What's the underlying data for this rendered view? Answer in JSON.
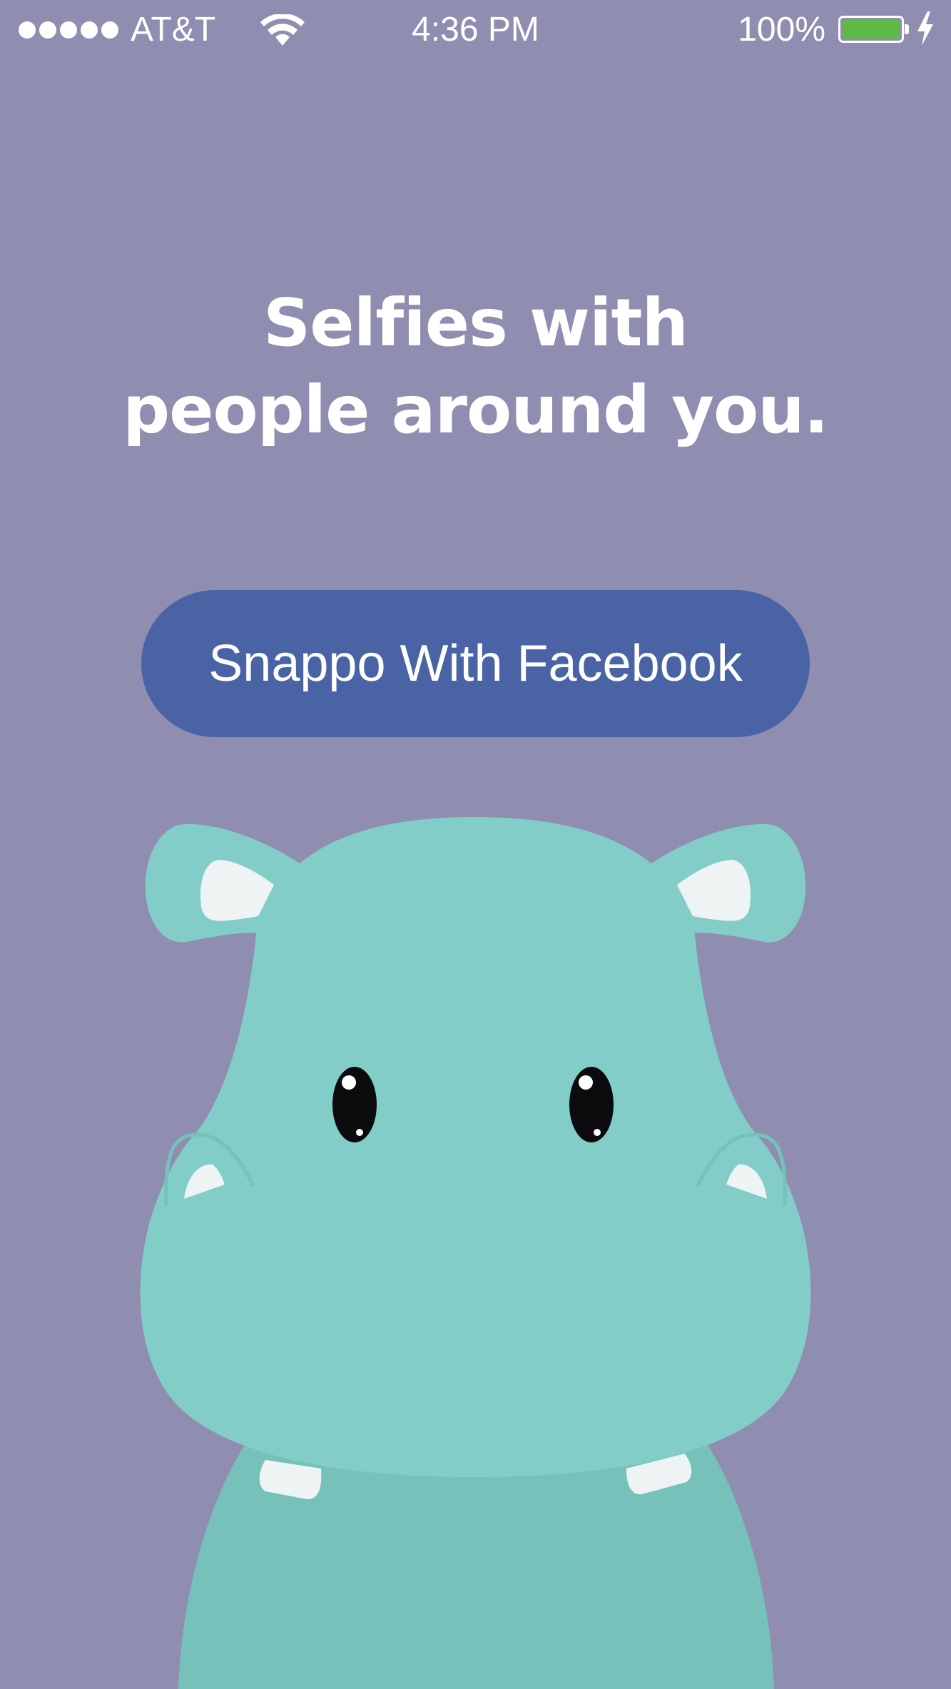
{
  "status_bar": {
    "carrier": "AT&T",
    "time": "4:36 PM",
    "battery_percent": "100%",
    "signal_bars": 5,
    "battery_level": 1.0,
    "icons": [
      "signal-dots-icon",
      "wifi-icon",
      "battery-icon",
      "charging-bolt-icon"
    ]
  },
  "headline": {
    "line1": "Selfies with",
    "line2": "people around you."
  },
  "login": {
    "facebook_button_label": "Snappo With Facebook"
  },
  "mascot": {
    "icon": "hippo-mascot-illustration"
  },
  "colors": {
    "background": "#8f8db0",
    "facebook_button": "#4a63a5",
    "hippo_head": "#83cdc8",
    "hippo_body": "#76c2bb",
    "battery_fill": "#5fb946",
    "text": "#ffffff"
  }
}
